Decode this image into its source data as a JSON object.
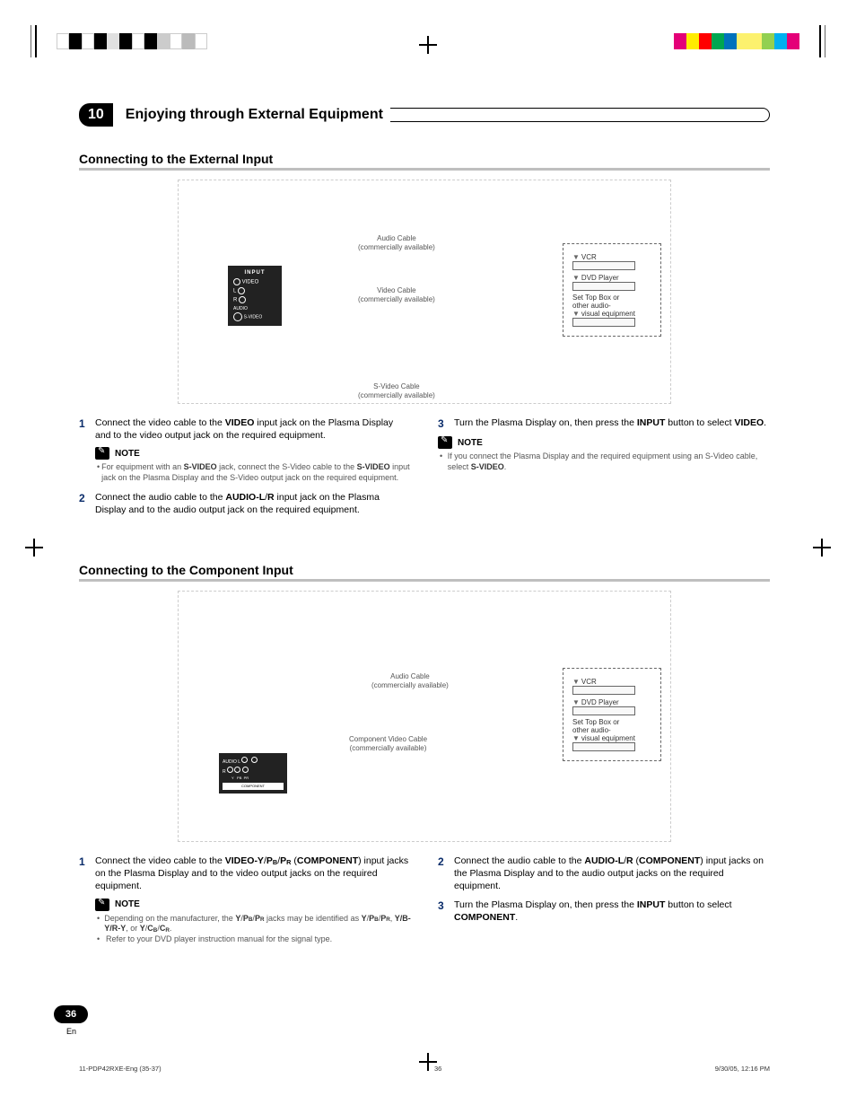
{
  "chapter": {
    "number": "10",
    "title": "Enjoying through External Equipment"
  },
  "section1": {
    "title": "Connecting to the External Input",
    "diagram": {
      "audio_cable": "Audio Cable",
      "commercially": "(commercially available)",
      "video_cable": "Video Cable",
      "svideo_cable": "S-Video Cable",
      "equip_vcr": "VCR",
      "equip_dvd": "DVD Player",
      "equip_stb1": "Set Top Box or",
      "equip_stb2": "other audio-",
      "equip_stb3": "visual equipment",
      "panel_input": "INPUT",
      "panel_video": "VIDEO",
      "panel_l": "L",
      "panel_r": "R",
      "panel_audio": "AUDIO",
      "panel_svideo": "S-VIDEO"
    },
    "steps": {
      "s1_pre": "Connect the video cable to the ",
      "s1_b1": "VIDEO",
      "s1_post": " input jack on the Plasma Display and to the video output jack on the required equipment.",
      "s2_pre": "Connect the audio cable to the ",
      "s2_b1": "AUDIO-L",
      "s2_mid": "/",
      "s2_b2": "R",
      "s2_post": " input jack on the Plasma Display and to the audio output jack on the required equipment.",
      "s3_pre": "Turn the Plasma Display on, then press the ",
      "s3_b1": "INPUT",
      "s3_mid": " button to select ",
      "s3_b2": "VIDEO",
      "s3_post": "."
    },
    "note1": {
      "label": "NOTE",
      "b1_pre": "For equipment with an ",
      "b1_b1": "S-VIDEO",
      "b1_mid": " jack, connect the S-Video cable to the ",
      "b1_b2": "S-VIDEO",
      "b1_post": " input jack on the Plasma Display and the S-Video output jack on the required equipment."
    },
    "note2": {
      "label": "NOTE",
      "b1_pre": "If you connect the Plasma Display and the required equipment using an S-Video cable, select ",
      "b1_b1": "S-VIDEO",
      "b1_post": "."
    }
  },
  "section2": {
    "title": "Connecting to the Component Input",
    "diagram": {
      "audio_cable": "Audio Cable",
      "commercially": "(commercially available)",
      "component_cable": "Component Video Cable",
      "equip_vcr": "VCR",
      "equip_dvd": "DVD Player",
      "equip_stb1": "Set Top Box or",
      "equip_stb2": "other audio-",
      "equip_stb3": "visual equipment",
      "panel_audio": "AUDIO",
      "panel_l": "L",
      "panel_r": "R",
      "panel_y": "Y",
      "panel_pb": "PB",
      "panel_pr": "PR",
      "panel_component": "COMPONENT"
    },
    "steps": {
      "s1_pre": "Connect the video cable to the ",
      "s1_b1": "VIDEO-Y",
      "s1_mid1": "/",
      "s1_b2a": "P",
      "s1_b2b": "B",
      "s1_mid2": "/",
      "s1_b3a": "P",
      "s1_b3b": "R",
      "s1_mid3": " (",
      "s1_b4": "COMPONENT",
      "s1_post": ") input jacks on the Plasma Display and to the video output jacks on the required equipment.",
      "s2_pre": "Connect the audio cable to the ",
      "s2_b1": "AUDIO-L",
      "s2_mid1": "/",
      "s2_b2": "R",
      "s2_mid2": " (",
      "s2_b3": "COMPONENT",
      "s2_post": ") input jacks on the Plasma Display and to the audio output jacks on the required equipment.",
      "s3_pre": "Turn the Plasma Display on, then press the ",
      "s3_b1": "INPUT",
      "s3_mid": " button to select ",
      "s3_b2": "COMPONENT",
      "s3_post": "."
    },
    "note": {
      "label": "NOTE",
      "b1_pre": "Depending on the manufacturer, the ",
      "b1_b1a": "Y",
      "b1_mid1": "/",
      "b1_b1ba": "P",
      "b1_b1bb": "B",
      "b1_mid2": "/",
      "b1_b1ca": "P",
      "b1_b1cb": "R",
      "b1_mid3": " jacks may be identified as ",
      "b1_b2a": "Y",
      "b1_m4": "/",
      "b1_b2ba": "P",
      "b1_b2bb": "B",
      "b1_m5": "/",
      "b1_b2ca": "P",
      "b1_b2cb": "R",
      "b1_m6": ", ",
      "b1_b3": "Y/B-Y/R-Y",
      "b1_m7": ", or ",
      "b1_b4a": "Y",
      "b1_m8": "/",
      "b1_b4ba": "C",
      "b1_b4bb": "B",
      "b1_m9": "/",
      "b1_b4ca": "C",
      "b1_b4cb": "R",
      "b1_post": ".",
      "b2": "Refer to your DVD player instruction manual for the signal type."
    }
  },
  "page": {
    "number": "36",
    "lang": "En"
  },
  "footer": {
    "file": "11-PDP42RXE-Eng (35-37)",
    "pg": "36",
    "date": "9/30/05, 12:16 PM"
  }
}
